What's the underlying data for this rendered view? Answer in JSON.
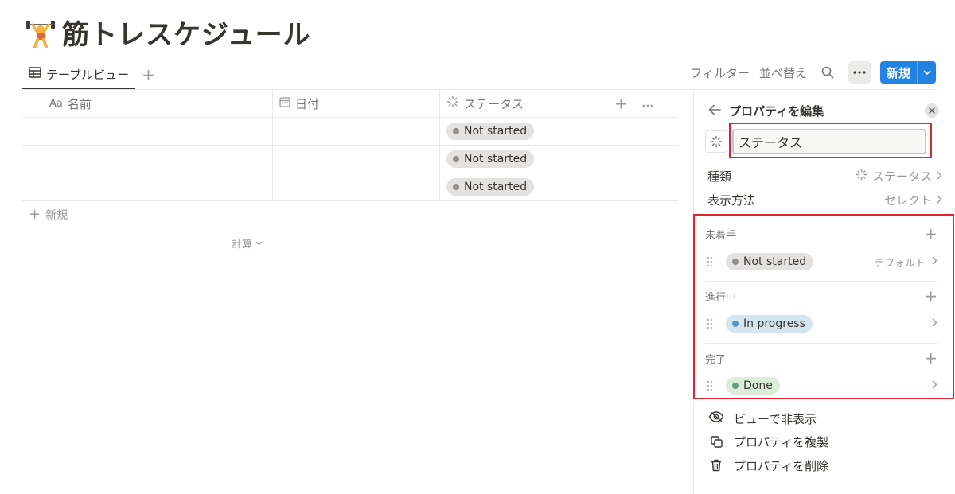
{
  "page": {
    "title": "筋トレスケジュール",
    "icon": "weightlifter-emoji"
  },
  "view_tabs": {
    "active_label": "テーブルビュー",
    "add_symbol": "+"
  },
  "toolbar": {
    "filter_label": "フィルター",
    "sort_label": "並べ替え",
    "search_icon": "search-icon",
    "more_icon": "ellipsis-icon",
    "new_label": "新規"
  },
  "table": {
    "columns": [
      {
        "icon_text": "Aa",
        "label": "名前"
      },
      {
        "icon": "calendar-icon",
        "label": "日付"
      },
      {
        "icon": "status-spinner-icon",
        "label": "ステータス"
      }
    ],
    "add_column_symbol": "+",
    "more_symbol": "…",
    "rows": [
      {
        "name": "",
        "date": "",
        "status": "Not started"
      },
      {
        "name": "",
        "date": "",
        "status": "Not started"
      },
      {
        "name": "",
        "date": "",
        "status": "Not started"
      }
    ],
    "new_row_label": "新規",
    "calc_label": "計算"
  },
  "panel": {
    "title": "プロパティを編集",
    "property_name": "ステータス",
    "type_label": "種類",
    "type_value": "ステータス",
    "display_label": "表示方法",
    "display_value": "セレクト",
    "groups": [
      {
        "name": "未着手",
        "option": "Not started",
        "color": "gray",
        "note": "デフォルト"
      },
      {
        "name": "進行中",
        "option": "In progress",
        "color": "blue",
        "note": ""
      },
      {
        "name": "完了",
        "option": "Done",
        "color": "green",
        "note": ""
      }
    ],
    "actions": {
      "hide": "ビューで非表示",
      "duplicate": "プロパティを複製",
      "delete": "プロパティを削除"
    }
  },
  "colors": {
    "accent": "#2383e2",
    "highlight_border": "#e0232f",
    "pill_gray": "#e3e2e0",
    "pill_blue": "#d3e5ef",
    "pill_green": "#dbeddb"
  }
}
